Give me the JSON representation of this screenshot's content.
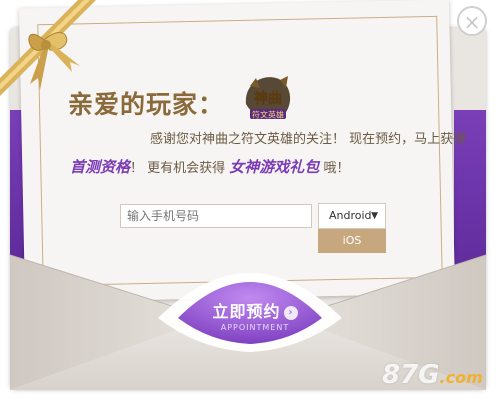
{
  "dialog": {
    "close_symbol": "×",
    "greeting": "亲爱的玩家：",
    "logo_text": [
      "神曲",
      "符文英雄"
    ],
    "line1": "感谢您对神曲之符文英雄的关注！ 现在预约，马上获得",
    "line2": {
      "highlight1": "首测资格",
      "middle": "！ 更有机会获得",
      "highlight2": "女神游戏礼包",
      "end": "哦！"
    },
    "phone_input": {
      "value": "",
      "placeholder": "输入手机号码"
    },
    "platform": {
      "selected": "Android",
      "arrow": "▼",
      "option": "iOS"
    },
    "appointment_button": {
      "label": "立即预约",
      "sublabel": "APPOINTMENT",
      "arrow": "›"
    }
  },
  "watermark": {
    "main": "87G",
    "domain": ".com"
  },
  "colors": {
    "purple": "#7b3bb5",
    "gold": "#c7a77e",
    "brown_text": "#8a6a3a",
    "envelope": "#e9e5e1"
  }
}
